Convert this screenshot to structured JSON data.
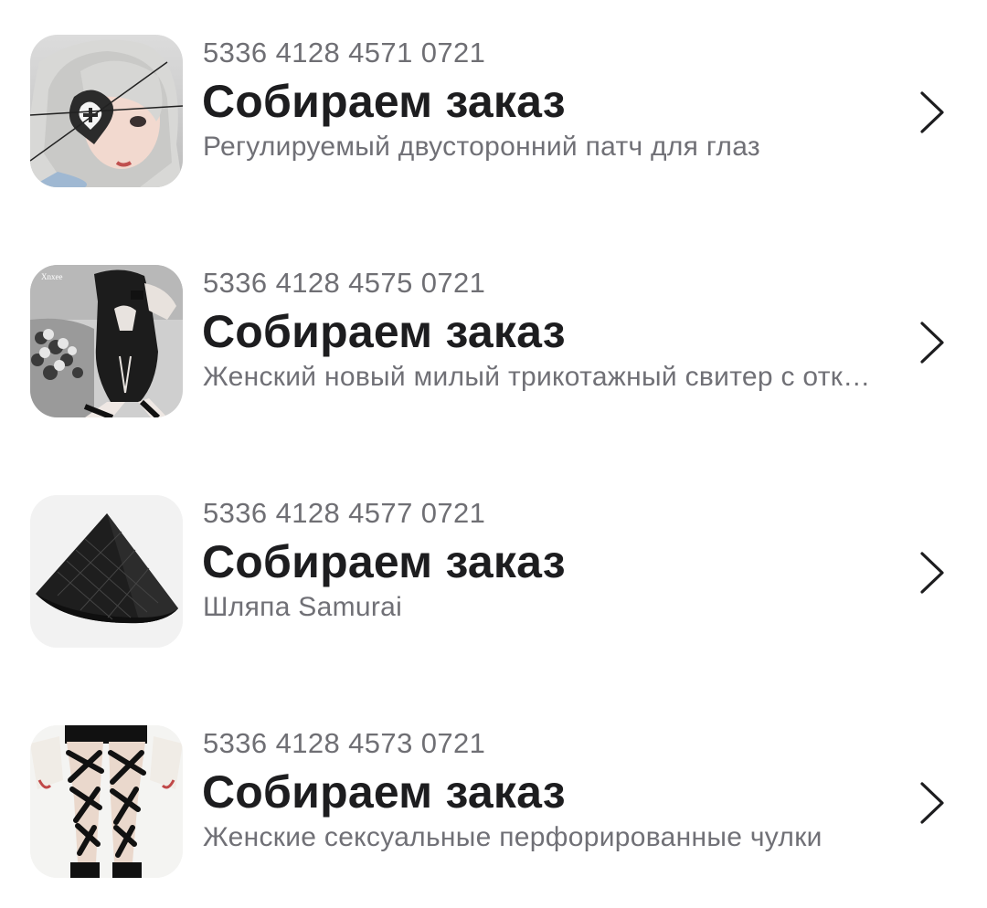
{
  "orders": [
    {
      "number": "5336 4128 4571 0721",
      "status": "Собираем заказ",
      "description": "Регулируемый двусторонний патч для глаз",
      "thumbnail": "eye-patch-photo",
      "chevron_icon": "chevron-right-icon"
    },
    {
      "number": "5336 4128 4575 0721",
      "status": "Собираем заказ",
      "description": "Женский новый милый трикотажный свитер с открытой спиной",
      "thumbnail": "knit-sweater-photo",
      "thumbnail_watermark": "Xnxee",
      "chevron_icon": "chevron-right-icon"
    },
    {
      "number": "5336 4128 4577 0721",
      "status": "Собираем заказ",
      "description": "Шляпа Samurai",
      "thumbnail": "samurai-hat-photo",
      "chevron_icon": "chevron-right-icon"
    },
    {
      "number": "5336 4128 4573 0721",
      "status": "Собираем заказ",
      "description": "Женские сексуальные перфорированные чулки",
      "thumbnail": "perforated-stockings-photo",
      "chevron_icon": "chevron-right-icon"
    }
  ],
  "colors": {
    "background": "#ffffff",
    "title": "#1d1d1f",
    "secondary_text": "#707076",
    "chevron": "#1d1d1f"
  }
}
